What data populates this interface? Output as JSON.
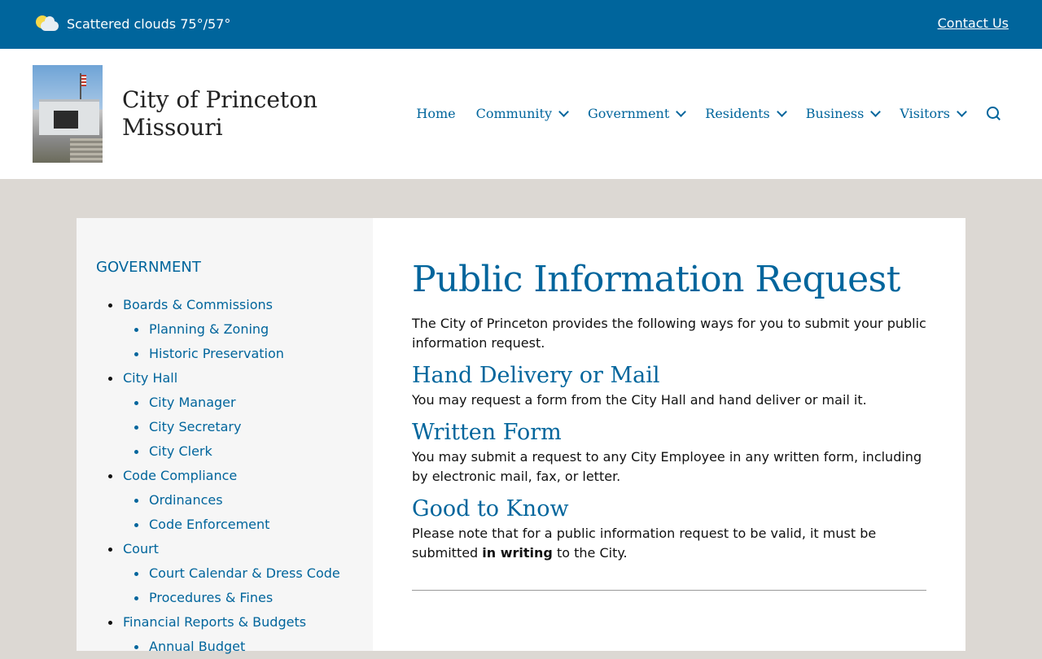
{
  "topbar": {
    "weather_text": "Scattered clouds 75°/57°",
    "weather_icon": "partly-cloudy-icon",
    "contact_label": "Contact Us",
    "background": "#00659c"
  },
  "header": {
    "title_line1": "City of Princeton",
    "title_line2": "Missouri",
    "nav": [
      {
        "label": "Home",
        "dropdown": false
      },
      {
        "label": "Community",
        "dropdown": true
      },
      {
        "label": "Government",
        "dropdown": true
      },
      {
        "label": "Residents",
        "dropdown": true
      },
      {
        "label": "Business",
        "dropdown": true
      },
      {
        "label": "Visitors",
        "dropdown": true
      }
    ],
    "accent": "#00659c"
  },
  "sidebar": {
    "heading": "GOVERNMENT",
    "items": [
      {
        "label": "Boards & Commissions",
        "level": 1
      },
      {
        "label": "Planning & Zoning",
        "level": 2
      },
      {
        "label": "Historic Preservation",
        "level": 2
      },
      {
        "label": "City Hall",
        "level": 1
      },
      {
        "label": "City Manager",
        "level": 2
      },
      {
        "label": "City Secretary",
        "level": 2
      },
      {
        "label": "City Clerk",
        "level": 2
      },
      {
        "label": "Code Compliance",
        "level": 1
      },
      {
        "label": "Ordinances",
        "level": 2
      },
      {
        "label": "Code Enforcement",
        "level": 2
      },
      {
        "label": "Court",
        "level": 1
      },
      {
        "label": "Court Calendar & Dress Code",
        "level": 2
      },
      {
        "label": "Procedures & Fines",
        "level": 2
      },
      {
        "label": "Financial Reports & Budgets",
        "level": 1
      },
      {
        "label": "Annual Budget",
        "level": 2
      }
    ]
  },
  "main": {
    "title": "Public Information Request",
    "intro": "The City of Princeton provides the following ways for you to submit your public information request.",
    "sections": [
      {
        "heading": "Hand Delivery or Mail",
        "text": "You may request a form from the City Hall and hand deliver or mail it."
      },
      {
        "heading": "Written Form",
        "text": "You may submit a request to any City Employee in any written form, including by electronic mail, fax, or letter."
      }
    ],
    "good_to_know": {
      "heading": "Good to Know",
      "text_before": "Please note that for a public information request to be valid, it must be submitted ",
      "text_bold": "in writing",
      "text_after": " to the City."
    }
  }
}
